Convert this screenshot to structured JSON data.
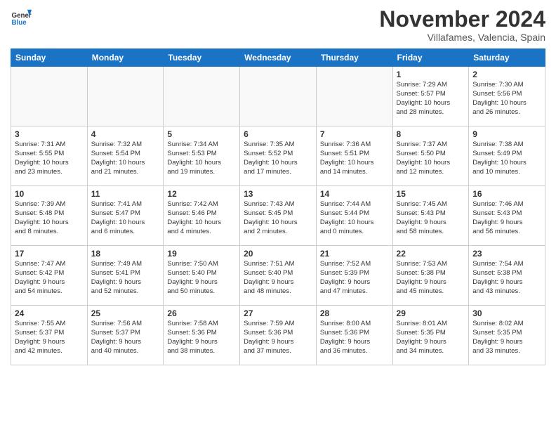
{
  "header": {
    "logo_line1": "General",
    "logo_line2": "Blue",
    "month": "November 2024",
    "location": "Villafames, Valencia, Spain"
  },
  "days_of_week": [
    "Sunday",
    "Monday",
    "Tuesday",
    "Wednesday",
    "Thursday",
    "Friday",
    "Saturday"
  ],
  "weeks": [
    [
      {
        "day": "",
        "info": ""
      },
      {
        "day": "",
        "info": ""
      },
      {
        "day": "",
        "info": ""
      },
      {
        "day": "",
        "info": ""
      },
      {
        "day": "",
        "info": ""
      },
      {
        "day": "1",
        "info": "Sunrise: 7:29 AM\nSunset: 5:57 PM\nDaylight: 10 hours\nand 28 minutes."
      },
      {
        "day": "2",
        "info": "Sunrise: 7:30 AM\nSunset: 5:56 PM\nDaylight: 10 hours\nand 26 minutes."
      }
    ],
    [
      {
        "day": "3",
        "info": "Sunrise: 7:31 AM\nSunset: 5:55 PM\nDaylight: 10 hours\nand 23 minutes."
      },
      {
        "day": "4",
        "info": "Sunrise: 7:32 AM\nSunset: 5:54 PM\nDaylight: 10 hours\nand 21 minutes."
      },
      {
        "day": "5",
        "info": "Sunrise: 7:34 AM\nSunset: 5:53 PM\nDaylight: 10 hours\nand 19 minutes."
      },
      {
        "day": "6",
        "info": "Sunrise: 7:35 AM\nSunset: 5:52 PM\nDaylight: 10 hours\nand 17 minutes."
      },
      {
        "day": "7",
        "info": "Sunrise: 7:36 AM\nSunset: 5:51 PM\nDaylight: 10 hours\nand 14 minutes."
      },
      {
        "day": "8",
        "info": "Sunrise: 7:37 AM\nSunset: 5:50 PM\nDaylight: 10 hours\nand 12 minutes."
      },
      {
        "day": "9",
        "info": "Sunrise: 7:38 AM\nSunset: 5:49 PM\nDaylight: 10 hours\nand 10 minutes."
      }
    ],
    [
      {
        "day": "10",
        "info": "Sunrise: 7:39 AM\nSunset: 5:48 PM\nDaylight: 10 hours\nand 8 minutes."
      },
      {
        "day": "11",
        "info": "Sunrise: 7:41 AM\nSunset: 5:47 PM\nDaylight: 10 hours\nand 6 minutes."
      },
      {
        "day": "12",
        "info": "Sunrise: 7:42 AM\nSunset: 5:46 PM\nDaylight: 10 hours\nand 4 minutes."
      },
      {
        "day": "13",
        "info": "Sunrise: 7:43 AM\nSunset: 5:45 PM\nDaylight: 10 hours\nand 2 minutes."
      },
      {
        "day": "14",
        "info": "Sunrise: 7:44 AM\nSunset: 5:44 PM\nDaylight: 10 hours\nand 0 minutes."
      },
      {
        "day": "15",
        "info": "Sunrise: 7:45 AM\nSunset: 5:43 PM\nDaylight: 9 hours\nand 58 minutes."
      },
      {
        "day": "16",
        "info": "Sunrise: 7:46 AM\nSunset: 5:43 PM\nDaylight: 9 hours\nand 56 minutes."
      }
    ],
    [
      {
        "day": "17",
        "info": "Sunrise: 7:47 AM\nSunset: 5:42 PM\nDaylight: 9 hours\nand 54 minutes."
      },
      {
        "day": "18",
        "info": "Sunrise: 7:49 AM\nSunset: 5:41 PM\nDaylight: 9 hours\nand 52 minutes."
      },
      {
        "day": "19",
        "info": "Sunrise: 7:50 AM\nSunset: 5:40 PM\nDaylight: 9 hours\nand 50 minutes."
      },
      {
        "day": "20",
        "info": "Sunrise: 7:51 AM\nSunset: 5:40 PM\nDaylight: 9 hours\nand 48 minutes."
      },
      {
        "day": "21",
        "info": "Sunrise: 7:52 AM\nSunset: 5:39 PM\nDaylight: 9 hours\nand 47 minutes."
      },
      {
        "day": "22",
        "info": "Sunrise: 7:53 AM\nSunset: 5:38 PM\nDaylight: 9 hours\nand 45 minutes."
      },
      {
        "day": "23",
        "info": "Sunrise: 7:54 AM\nSunset: 5:38 PM\nDaylight: 9 hours\nand 43 minutes."
      }
    ],
    [
      {
        "day": "24",
        "info": "Sunrise: 7:55 AM\nSunset: 5:37 PM\nDaylight: 9 hours\nand 42 minutes."
      },
      {
        "day": "25",
        "info": "Sunrise: 7:56 AM\nSunset: 5:37 PM\nDaylight: 9 hours\nand 40 minutes."
      },
      {
        "day": "26",
        "info": "Sunrise: 7:58 AM\nSunset: 5:36 PM\nDaylight: 9 hours\nand 38 minutes."
      },
      {
        "day": "27",
        "info": "Sunrise: 7:59 AM\nSunset: 5:36 PM\nDaylight: 9 hours\nand 37 minutes."
      },
      {
        "day": "28",
        "info": "Sunrise: 8:00 AM\nSunset: 5:36 PM\nDaylight: 9 hours\nand 36 minutes."
      },
      {
        "day": "29",
        "info": "Sunrise: 8:01 AM\nSunset: 5:35 PM\nDaylight: 9 hours\nand 34 minutes."
      },
      {
        "day": "30",
        "info": "Sunrise: 8:02 AM\nSunset: 5:35 PM\nDaylight: 9 hours\nand 33 minutes."
      }
    ]
  ]
}
